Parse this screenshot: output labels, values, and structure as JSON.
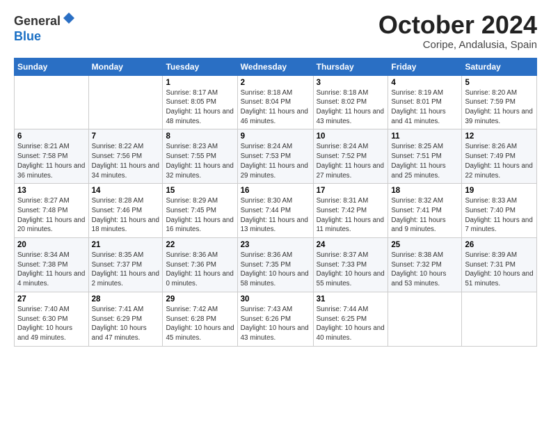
{
  "header": {
    "logo_line1": "General",
    "logo_line2": "Blue",
    "month_title": "October 2024",
    "location": "Coripe, Andalusia, Spain"
  },
  "weekdays": [
    "Sunday",
    "Monday",
    "Tuesday",
    "Wednesday",
    "Thursday",
    "Friday",
    "Saturday"
  ],
  "weeks": [
    [
      {
        "day": "",
        "sunrise": "",
        "sunset": "",
        "daylight": ""
      },
      {
        "day": "",
        "sunrise": "",
        "sunset": "",
        "daylight": ""
      },
      {
        "day": "1",
        "sunrise": "Sunrise: 8:17 AM",
        "sunset": "Sunset: 8:05 PM",
        "daylight": "Daylight: 11 hours and 48 minutes."
      },
      {
        "day": "2",
        "sunrise": "Sunrise: 8:18 AM",
        "sunset": "Sunset: 8:04 PM",
        "daylight": "Daylight: 11 hours and 46 minutes."
      },
      {
        "day": "3",
        "sunrise": "Sunrise: 8:18 AM",
        "sunset": "Sunset: 8:02 PM",
        "daylight": "Daylight: 11 hours and 43 minutes."
      },
      {
        "day": "4",
        "sunrise": "Sunrise: 8:19 AM",
        "sunset": "Sunset: 8:01 PM",
        "daylight": "Daylight: 11 hours and 41 minutes."
      },
      {
        "day": "5",
        "sunrise": "Sunrise: 8:20 AM",
        "sunset": "Sunset: 7:59 PM",
        "daylight": "Daylight: 11 hours and 39 minutes."
      }
    ],
    [
      {
        "day": "6",
        "sunrise": "Sunrise: 8:21 AM",
        "sunset": "Sunset: 7:58 PM",
        "daylight": "Daylight: 11 hours and 36 minutes."
      },
      {
        "day": "7",
        "sunrise": "Sunrise: 8:22 AM",
        "sunset": "Sunset: 7:56 PM",
        "daylight": "Daylight: 11 hours and 34 minutes."
      },
      {
        "day": "8",
        "sunrise": "Sunrise: 8:23 AM",
        "sunset": "Sunset: 7:55 PM",
        "daylight": "Daylight: 11 hours and 32 minutes."
      },
      {
        "day": "9",
        "sunrise": "Sunrise: 8:24 AM",
        "sunset": "Sunset: 7:53 PM",
        "daylight": "Daylight: 11 hours and 29 minutes."
      },
      {
        "day": "10",
        "sunrise": "Sunrise: 8:24 AM",
        "sunset": "Sunset: 7:52 PM",
        "daylight": "Daylight: 11 hours and 27 minutes."
      },
      {
        "day": "11",
        "sunrise": "Sunrise: 8:25 AM",
        "sunset": "Sunset: 7:51 PM",
        "daylight": "Daylight: 11 hours and 25 minutes."
      },
      {
        "day": "12",
        "sunrise": "Sunrise: 8:26 AM",
        "sunset": "Sunset: 7:49 PM",
        "daylight": "Daylight: 11 hours and 22 minutes."
      }
    ],
    [
      {
        "day": "13",
        "sunrise": "Sunrise: 8:27 AM",
        "sunset": "Sunset: 7:48 PM",
        "daylight": "Daylight: 11 hours and 20 minutes."
      },
      {
        "day": "14",
        "sunrise": "Sunrise: 8:28 AM",
        "sunset": "Sunset: 7:46 PM",
        "daylight": "Daylight: 11 hours and 18 minutes."
      },
      {
        "day": "15",
        "sunrise": "Sunrise: 8:29 AM",
        "sunset": "Sunset: 7:45 PM",
        "daylight": "Daylight: 11 hours and 16 minutes."
      },
      {
        "day": "16",
        "sunrise": "Sunrise: 8:30 AM",
        "sunset": "Sunset: 7:44 PM",
        "daylight": "Daylight: 11 hours and 13 minutes."
      },
      {
        "day": "17",
        "sunrise": "Sunrise: 8:31 AM",
        "sunset": "Sunset: 7:42 PM",
        "daylight": "Daylight: 11 hours and 11 minutes."
      },
      {
        "day": "18",
        "sunrise": "Sunrise: 8:32 AM",
        "sunset": "Sunset: 7:41 PM",
        "daylight": "Daylight: 11 hours and 9 minutes."
      },
      {
        "day": "19",
        "sunrise": "Sunrise: 8:33 AM",
        "sunset": "Sunset: 7:40 PM",
        "daylight": "Daylight: 11 hours and 7 minutes."
      }
    ],
    [
      {
        "day": "20",
        "sunrise": "Sunrise: 8:34 AM",
        "sunset": "Sunset: 7:38 PM",
        "daylight": "Daylight: 11 hours and 4 minutes."
      },
      {
        "day": "21",
        "sunrise": "Sunrise: 8:35 AM",
        "sunset": "Sunset: 7:37 PM",
        "daylight": "Daylight: 11 hours and 2 minutes."
      },
      {
        "day": "22",
        "sunrise": "Sunrise: 8:36 AM",
        "sunset": "Sunset: 7:36 PM",
        "daylight": "Daylight: 11 hours and 0 minutes."
      },
      {
        "day": "23",
        "sunrise": "Sunrise: 8:36 AM",
        "sunset": "Sunset: 7:35 PM",
        "daylight": "Daylight: 10 hours and 58 minutes."
      },
      {
        "day": "24",
        "sunrise": "Sunrise: 8:37 AM",
        "sunset": "Sunset: 7:33 PM",
        "daylight": "Daylight: 10 hours and 55 minutes."
      },
      {
        "day": "25",
        "sunrise": "Sunrise: 8:38 AM",
        "sunset": "Sunset: 7:32 PM",
        "daylight": "Daylight: 10 hours and 53 minutes."
      },
      {
        "day": "26",
        "sunrise": "Sunrise: 8:39 AM",
        "sunset": "Sunset: 7:31 PM",
        "daylight": "Daylight: 10 hours and 51 minutes."
      }
    ],
    [
      {
        "day": "27",
        "sunrise": "Sunrise: 7:40 AM",
        "sunset": "Sunset: 6:30 PM",
        "daylight": "Daylight: 10 hours and 49 minutes."
      },
      {
        "day": "28",
        "sunrise": "Sunrise: 7:41 AM",
        "sunset": "Sunset: 6:29 PM",
        "daylight": "Daylight: 10 hours and 47 minutes."
      },
      {
        "day": "29",
        "sunrise": "Sunrise: 7:42 AM",
        "sunset": "Sunset: 6:28 PM",
        "daylight": "Daylight: 10 hours and 45 minutes."
      },
      {
        "day": "30",
        "sunrise": "Sunrise: 7:43 AM",
        "sunset": "Sunset: 6:26 PM",
        "daylight": "Daylight: 10 hours and 43 minutes."
      },
      {
        "day": "31",
        "sunrise": "Sunrise: 7:44 AM",
        "sunset": "Sunset: 6:25 PM",
        "daylight": "Daylight: 10 hours and 40 minutes."
      },
      {
        "day": "",
        "sunrise": "",
        "sunset": "",
        "daylight": ""
      },
      {
        "day": "",
        "sunrise": "",
        "sunset": "",
        "daylight": ""
      }
    ]
  ]
}
